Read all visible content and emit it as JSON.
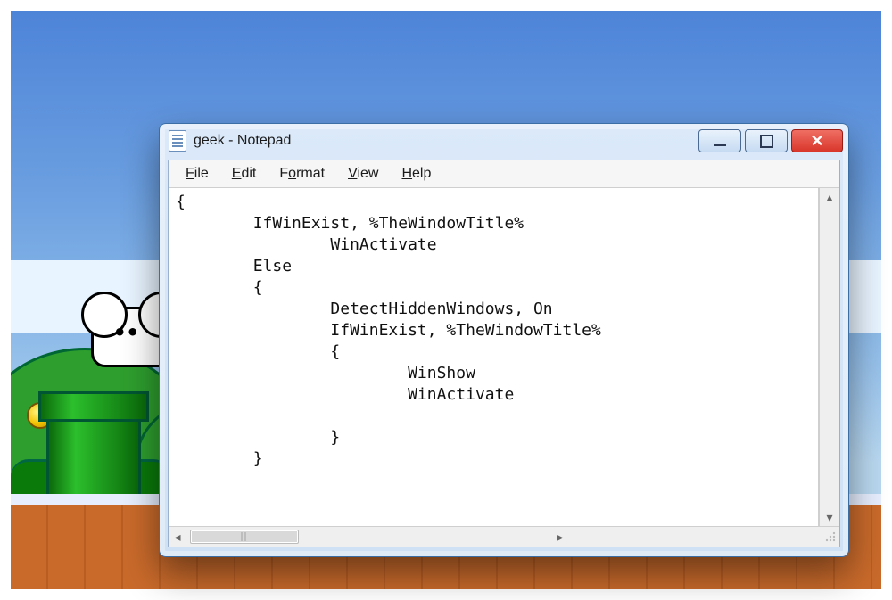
{
  "window": {
    "title": "geek - Notepad",
    "buttons": {
      "minimize": "Minimize",
      "maximize": "Maximize",
      "close": "Close"
    }
  },
  "menu": {
    "file": {
      "label": "File",
      "mnemonic": "F"
    },
    "edit": {
      "label": "Edit",
      "mnemonic": "E"
    },
    "format": {
      "label": "Format",
      "mnemonic": "o"
    },
    "view": {
      "label": "View",
      "mnemonic": "V"
    },
    "help": {
      "label": "Help",
      "mnemonic": "H"
    }
  },
  "editor": {
    "text": "{\n        IfWinExist, %TheWindowTitle%\n                WinActivate\n        Else\n        {\n                DetectHiddenWindows, On\n                IfWinExist, %TheWindowTitle%\n                {\n                        WinShow\n                        WinActivate\n\n                }\n        }"
  },
  "icons": {
    "notepad": "notepad-icon",
    "minimize": "minimize-icon",
    "maximize": "maximize-icon",
    "close": "close-icon",
    "scroll_up": "chevron-up-icon",
    "scroll_down": "chevron-down-icon",
    "scroll_left": "chevron-left-icon",
    "scroll_right": "chevron-right-icon",
    "resize_grip": "resize-grip-icon"
  }
}
